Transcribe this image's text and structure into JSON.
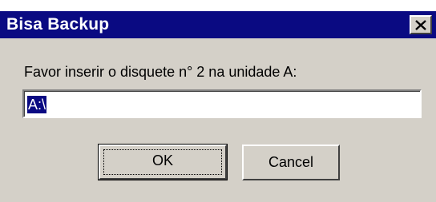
{
  "window": {
    "title": "Bisa Backup",
    "close_icon": "close-x-icon"
  },
  "dialog": {
    "prompt": "Favor inserir o disquete n° 2 na unidade A:",
    "path_value": "A:\\",
    "ok_label": "OK",
    "cancel_label": "Cancel"
  },
  "colors": {
    "titlebar": "#0a0a82",
    "dialog_face": "#d4d0c8",
    "selection": "#0a0a82"
  }
}
